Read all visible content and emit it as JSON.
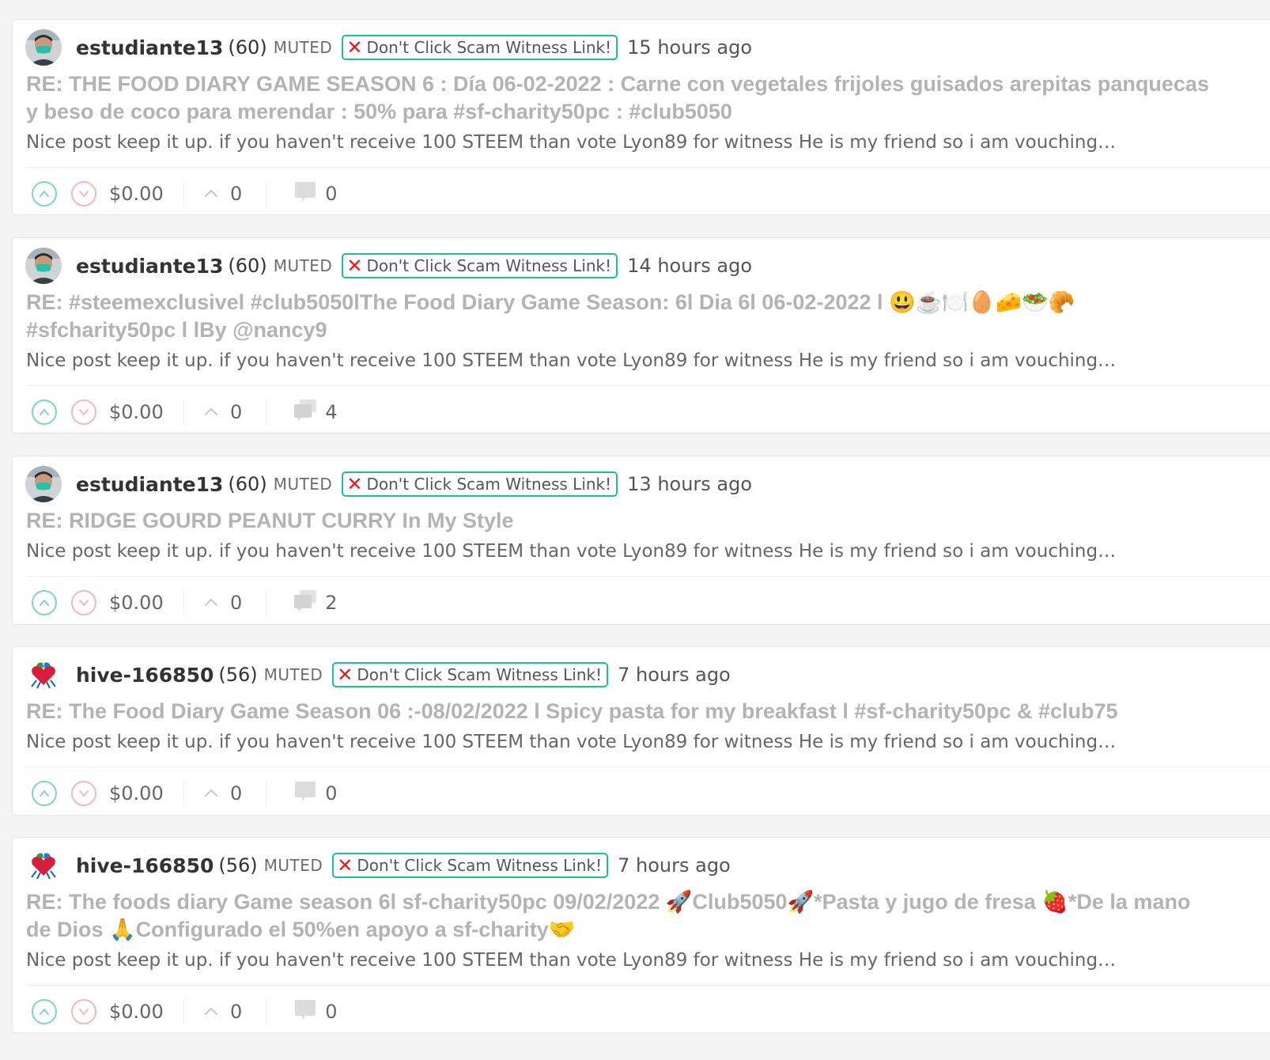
{
  "posts": [
    {
      "author": "estudiante13",
      "reputation": "(60)",
      "muted_label": "MUTED",
      "warning_label": "Don't Click Scam Witness Link!",
      "time": "15 hours ago",
      "title": "RE: THE FOOD DIARY GAME SEASON 6 : Día 06-02-2022 : Carne con vegetales frijoles guisados arepitas panquecas y beso de coco para merendar : 50% para #sf-charity50pc : #club5050",
      "body": "Nice post keep it up. if you haven't receive 100 STEEM than vote Lyon89 for witness He is my friend so i am vouching…",
      "payout": "$0.00",
      "votes": "0",
      "replies": "0",
      "avatar": "person-avatar"
    },
    {
      "author": "estudiante13",
      "reputation": "(60)",
      "muted_label": "MUTED",
      "warning_label": "Don't Click Scam Witness Link!",
      "time": "14 hours ago",
      "title": "RE: #steemexclusivel #club5050lThe Food Diary Game Season: 6l Dia 6l 06-02-2022 l 😃☕🍽️🥚🧀🥗🥐 #sfcharity50pc l lBy @nancy9",
      "body": "Nice post keep it up. if you haven't receive 100 STEEM than vote Lyon89 for witness He is my friend so i am vouching…",
      "payout": "$0.00",
      "votes": "0",
      "replies": "4",
      "avatar": "person-avatar"
    },
    {
      "author": "estudiante13",
      "reputation": "(60)",
      "muted_label": "MUTED",
      "warning_label": "Don't Click Scam Witness Link!",
      "time": "13 hours ago",
      "title": "RE: RIDGE GOURD PEANUT CURRY In My Style",
      "body": "Nice post keep it up. if you haven't receive 100 STEEM than vote Lyon89 for witness He is my friend so i am vouching…",
      "payout": "$0.00",
      "votes": "0",
      "replies": "2",
      "avatar": "person-avatar"
    },
    {
      "author": "hive-166850",
      "reputation": "(56)",
      "muted_label": "MUTED",
      "warning_label": "Don't Click Scam Witness Link!",
      "time": "7 hours ago",
      "title": "RE: The Food Diary Game Season 06 :-08/02/2022 l Spicy pasta for my breakfast l #sf-charity50pc & #club75",
      "body": "Nice post keep it up. if you haven't receive 100 STEEM than vote Lyon89 for witness He is my friend so i am vouching…",
      "payout": "$0.00",
      "votes": "0",
      "replies": "0",
      "avatar": "community-avatar"
    },
    {
      "author": "hive-166850",
      "reputation": "(56)",
      "muted_label": "MUTED",
      "warning_label": "Don't Click Scam Witness Link!",
      "time": "7 hours ago",
      "title": "RE: The foods diary Game season 6l sf-charity50pc 09/02/2022 🚀Club5050🚀*Pasta y jugo de fresa 🍓*De la mano de Dios 🙏Configurado el 50%en apoyo a sf-charity🤝",
      "body": "Nice post keep it up. if you haven't receive 100 STEEM than vote Lyon89 for witness He is my friend so i am vouching…",
      "payout": "$0.00",
      "votes": "0",
      "replies": "0",
      "avatar": "community-avatar"
    }
  ],
  "colors": {
    "warning_border": "#1fbf8f",
    "upvote": "#82d5bb",
    "downvote": "#f3b8b8",
    "title_gray": "#b3b3b3"
  }
}
